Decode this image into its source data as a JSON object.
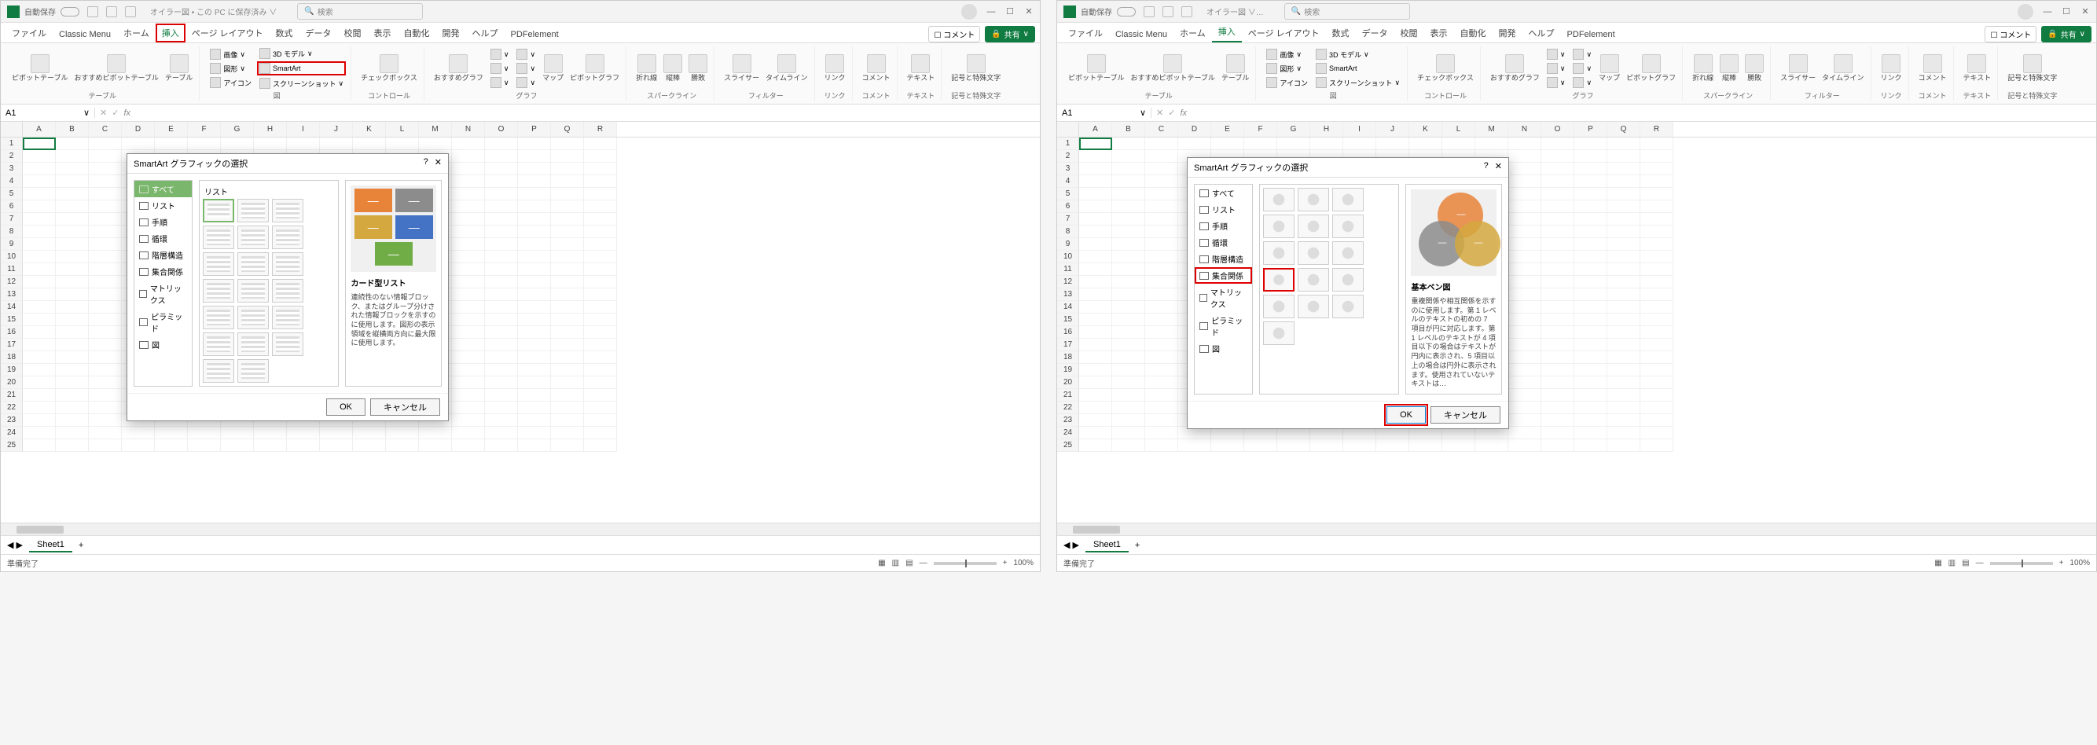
{
  "titlebar": {
    "autosave": "自動保存",
    "doc_name_left": "オイラー図 • この PC に保存済み ∨",
    "doc_name_right": "オイラー図 ∨…",
    "search_placeholder": "検索"
  },
  "tabs": {
    "file": "ファイル",
    "classic": "Classic Menu",
    "home": "ホーム",
    "insert": "挿入",
    "page_layout": "ページ レイアウト",
    "formulas": "数式",
    "data": "データ",
    "review": "校閲",
    "view": "表示",
    "automate": "自動化",
    "developer": "開発",
    "help": "ヘルプ",
    "pdfelement": "PDFelement",
    "comment": "コメント",
    "share": "共有"
  },
  "ribbon": {
    "tables": {
      "pivot": "ピボットテーブル",
      "recommended_pivot": "おすすめピボットテーブル",
      "table": "テーブル",
      "group": "テーブル"
    },
    "illustrations": {
      "picture": "画像",
      "shape": "図形",
      "icon": "アイコン",
      "model3d": "3D モデル",
      "smartart": "SmartArt",
      "screenshot": "スクリーンショット",
      "group": "図"
    },
    "addins": {
      "checkbox": "チェックボックス",
      "group": "コントロール"
    },
    "charts": {
      "recommended": "おすすめグラフ",
      "map": "マップ",
      "pivot_chart": "ピボットグラフ",
      "group": "グラフ"
    },
    "sparklines": {
      "line": "折れ線",
      "column": "縦棒",
      "winloss": "勝敗",
      "group": "スパークライン"
    },
    "filters": {
      "slicer": "スライサー",
      "timeline": "タイムライン",
      "group": "フィルター"
    },
    "links": {
      "link": "リンク",
      "group": "リンク"
    },
    "comments": {
      "comment": "コメント",
      "group": "コメント"
    },
    "text": {
      "textbox": "テキスト",
      "group": "テキスト"
    },
    "symbols": {
      "symbol": "記号と特殊文字",
      "group": "記号と特殊文字"
    }
  },
  "formula_bar": {
    "cell_ref": "A1",
    "fx": "fx"
  },
  "columns": [
    "A",
    "B",
    "C",
    "D",
    "E",
    "F",
    "G",
    "H",
    "I",
    "J",
    "K",
    "L",
    "M",
    "N",
    "O",
    "P",
    "Q",
    "R"
  ],
  "rows": [
    1,
    2,
    3,
    4,
    5,
    6,
    7,
    8,
    9,
    10,
    11,
    12,
    13,
    14,
    15,
    16,
    17,
    18,
    19,
    20,
    21,
    22,
    23,
    24,
    25
  ],
  "dialog_left": {
    "title": "SmartArt グラフィックの選択",
    "categories": [
      "すべて",
      "リスト",
      "手順",
      "循環",
      "階層構造",
      "集合関係",
      "マトリックス",
      "ピラミッド",
      "図"
    ],
    "selected_cat": "すべて",
    "layouts_title": "リスト",
    "preview_title": "カード型リスト",
    "preview_desc": "連続性のない情報ブロック、またはグループ分けされた情報ブロックを示すのに使用します。図形の表示領域を縦横両方向に最大限に使用します。",
    "ok": "OK",
    "cancel": "キャンセル",
    "preview_colors": [
      "#e8833a",
      "#8c8c8c",
      "#d4a83e",
      "#4472c4",
      "#70ad47"
    ]
  },
  "dialog_right": {
    "title": "SmartArt グラフィックの選択",
    "categories": [
      "すべて",
      "リスト",
      "手順",
      "循環",
      "階層構造",
      "集合関係",
      "マトリックス",
      "ピラミッド",
      "図"
    ],
    "selected_cat": "集合関係",
    "preview_title": "基本ベン図",
    "preview_desc": "重複関係や相互関係を示すのに使用します。第 1 レベルのテキストの初めの 7 項目が円に対応します。第 1 レベルのテキストが 4 項目以下の場合はテキストが円内に表示され、5 項目以上の場合は円外に表示されます。使用されていないテキストは…",
    "ok": "OK",
    "cancel": "キャンセル",
    "venn_colors": [
      "#e8833a",
      "#8c8c8c",
      "#d4a83e"
    ]
  },
  "sheet_tabs": {
    "sheet1": "Sheet1"
  },
  "status": {
    "ready": "準備完了",
    "zoom": "100%"
  }
}
